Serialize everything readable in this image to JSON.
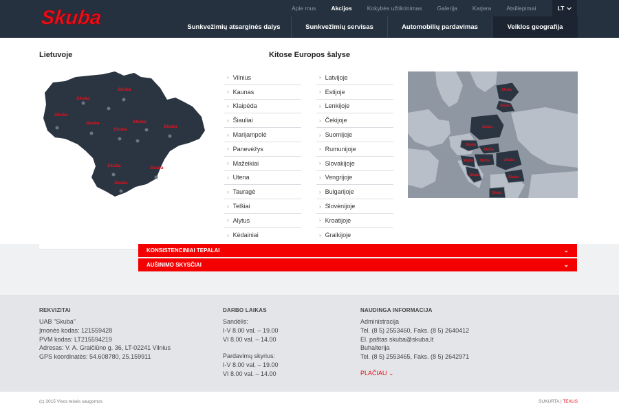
{
  "brand": {
    "logo_text": "Skuba",
    "accent": "#e8101a",
    "header_bg": "#25313e"
  },
  "topnav": {
    "items": [
      "Apie mus",
      "Akcijos",
      "Kokybės užtikrinimas",
      "Galerija",
      "Karjera",
      "Atsiliepimai"
    ],
    "active_index": 1,
    "lang": "LT",
    "lang_icon": "chevron-down-icon"
  },
  "mainnav": {
    "items": [
      "Sunkvežimių atsarginės dalys",
      "Sunkvežimių servisas",
      "Automobilių pardavimas",
      "Veiklos geografija"
    ],
    "active_index": 3
  },
  "panel": {
    "lithuania_title": "Lietuvoje",
    "europe_title": "Kitose Europos šalyse",
    "map_marker_label": "Skuba",
    "lt_cities": [
      "Vilnius",
      "Kaunas",
      "Klaipėda",
      "Šiauliai",
      "Marijampolė",
      "Panevėžys",
      "Mažeikiai",
      "Utena",
      "Tauragė",
      "Telšiai",
      "Alytus",
      "Kėdainiai"
    ],
    "eu_countries": [
      "Latvijoje",
      "Estijoje",
      "Lenkijoje",
      "Čekijoje",
      "Suomijoje",
      "Rumunijoje",
      "Slovakijoje",
      "Vengrijoje",
      "Bulgarijoje",
      "Slovėnijoje",
      "Kroatijoje",
      "Graikijoje"
    ]
  },
  "accordion": {
    "rows": [
      "KONSISTENCINIAI TEPALAI",
      "AUŠINIMO SKYSČIAI"
    ]
  },
  "footer": {
    "rekvizitai": {
      "title": "REKVIZITAI",
      "lines": [
        "UAB \"Skuba\"",
        "Įmonės kodas: 121559428",
        "PVM kodas: LT215594219",
        "Adresas: V. A. Graičiūno g. 36, LT-02241 Vilnius",
        "GPS koordinatės: 54.608780, 25.159911"
      ]
    },
    "darbo_laikas": {
      "title": "DARBO LAIKAS",
      "sandelis_label": "Sandėlis:",
      "sandelis_lines": [
        "I-V 8.00 val. – 19.00",
        "VI  8.00 val. – 14.00"
      ],
      "pardavimu_label": "Pardavimų skyrius:",
      "pardavimu_lines": [
        "I-V 8.00 val. – 19.00",
        "VI  8.00 val. – 14.00"
      ]
    },
    "naudinga": {
      "title": "NAUDINGA INFORMACIJA",
      "lines": [
        "Administracija",
        "Tel. (8 5) 2553460, Faks. (8 5) 2640412",
        "El. paštas skuba@skuba.lt",
        "Buhalterija",
        "Tel. (8 5) 2553465, Faks. (8 5) 2642971"
      ],
      "more_label": "PLAČIAU"
    },
    "copyright": "(c) 2015 Visos teisės saugomos",
    "credit_label": "SUKURTA",
    "credit_sep": " | ",
    "credit_brand": "TEXUS"
  }
}
